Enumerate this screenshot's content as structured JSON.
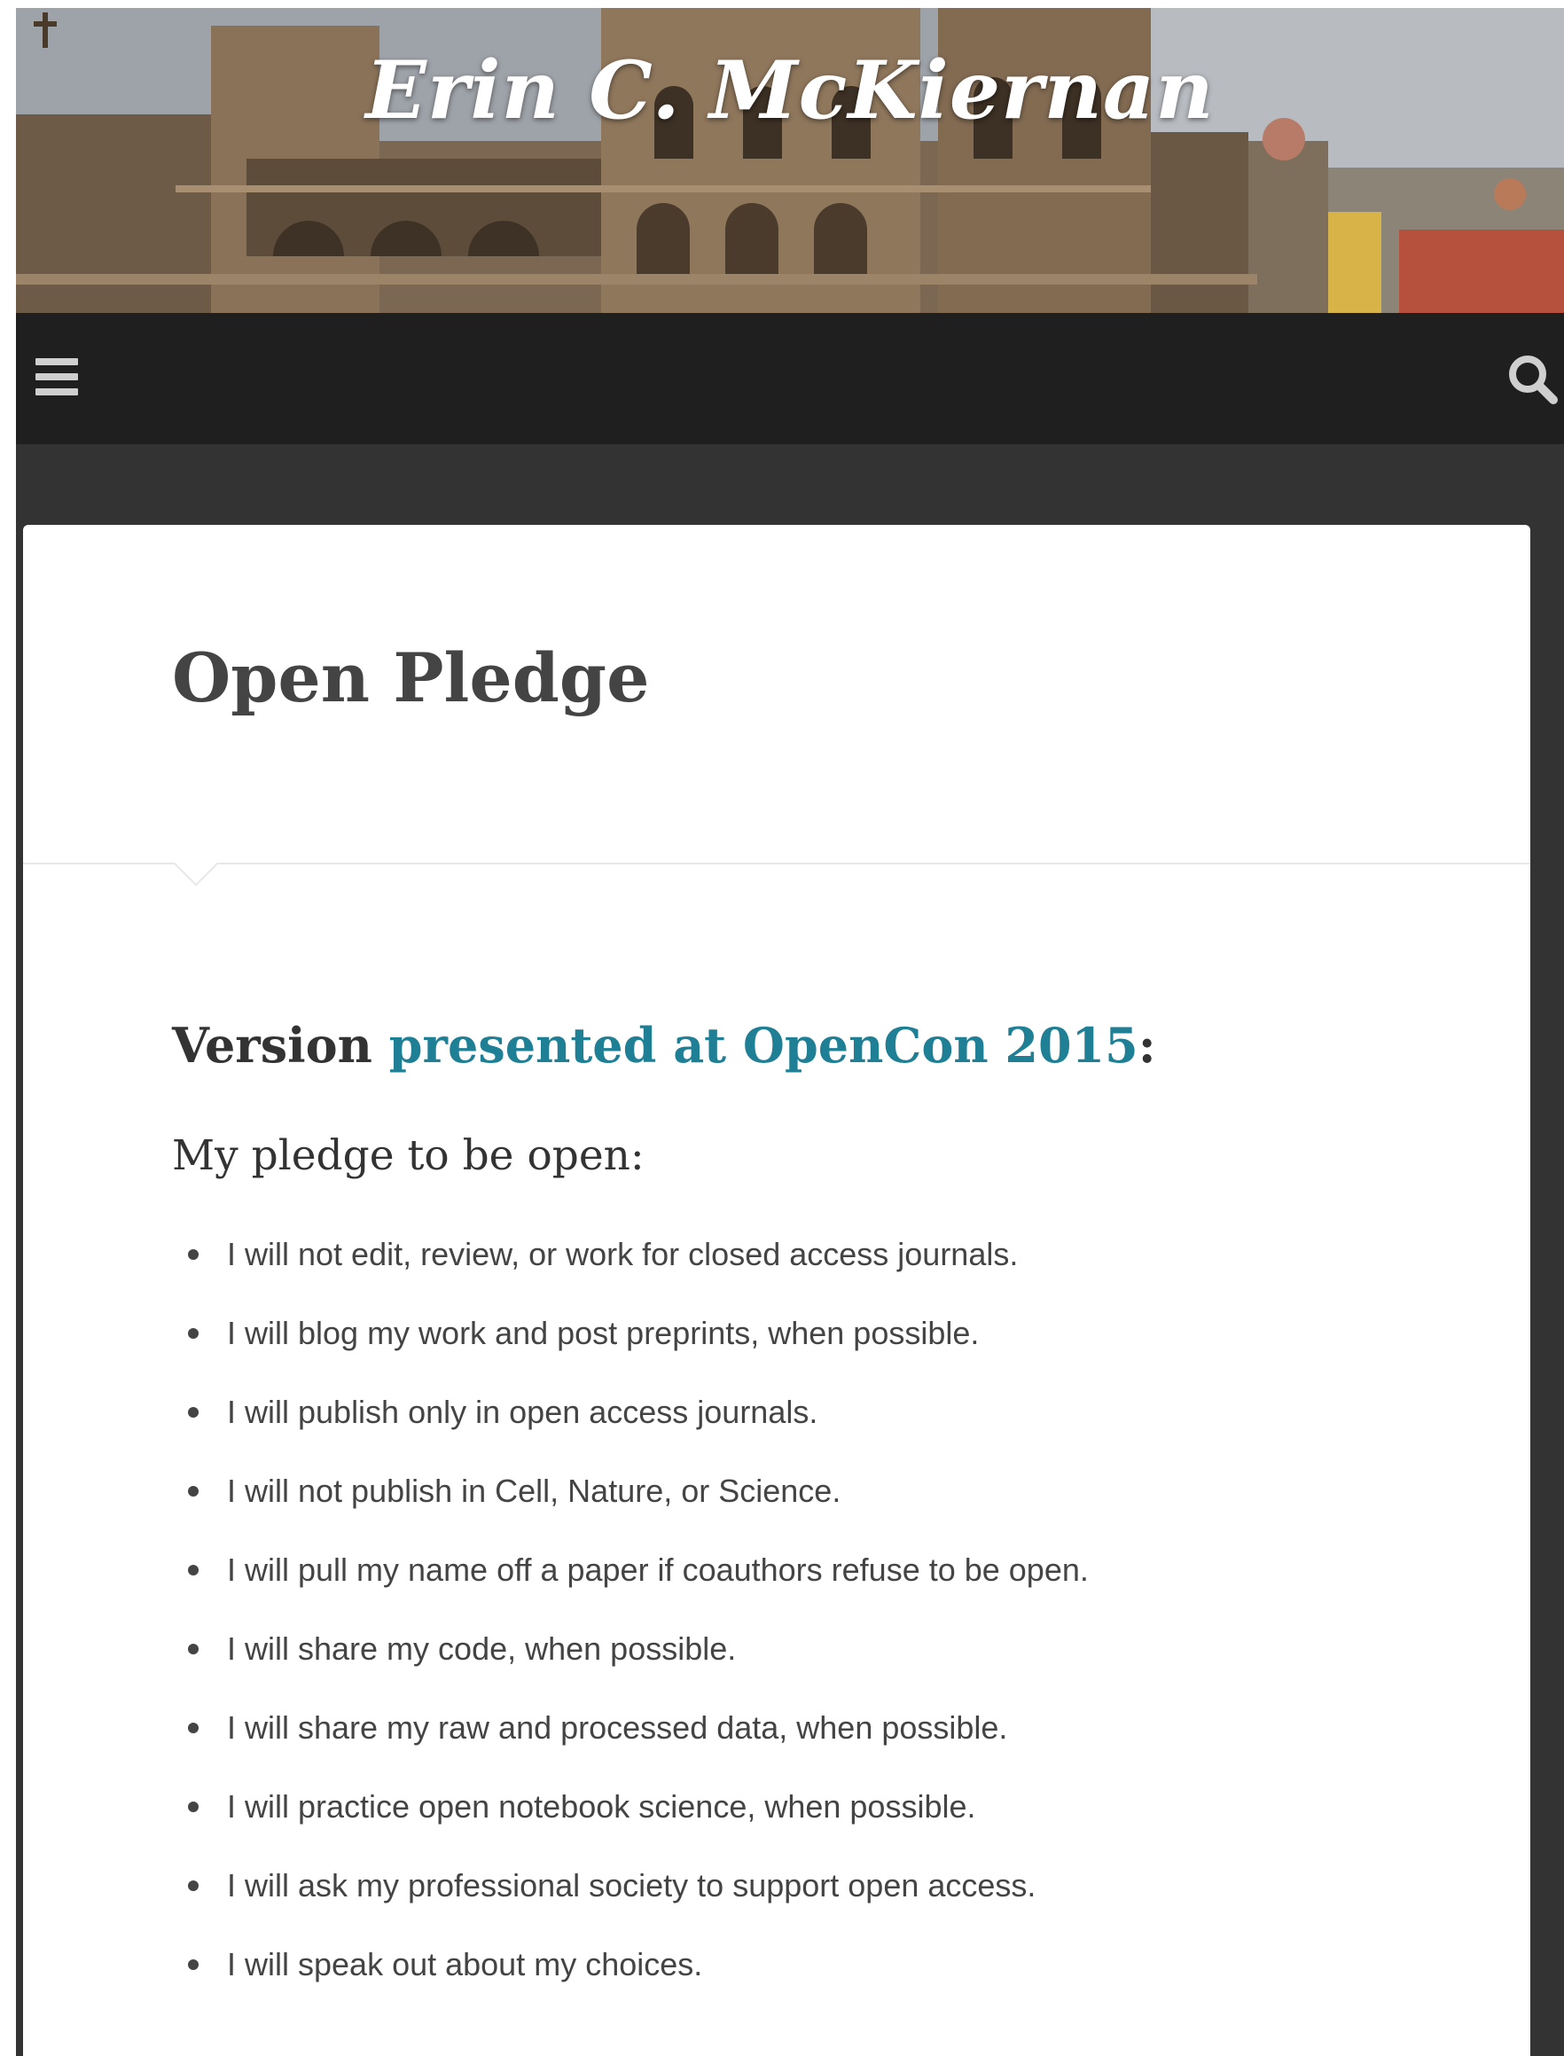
{
  "header": {
    "site_title": "Erin C. McKiernan",
    "banner_image": "cathedral-rooftops-photo"
  },
  "navbar": {
    "menu_icon": "hamburger-menu-icon",
    "search_icon": "search-icon"
  },
  "page": {
    "title": "Open Pledge",
    "version_prefix": "Version ",
    "version_link": "presented at OpenCon 2015",
    "version_suffix": ":",
    "intro": "My pledge to be open:",
    "pledges": [
      "I will not edit, review, or work for closed access journals.",
      "I will blog my work and post preprints, when possible.",
      "I will publish only in open access journals.",
      "I will not publish in Cell, Nature, or Science.",
      "I will pull my name off a paper if coauthors refuse to be open.",
      "I will share my code, when possible.",
      "I will share my raw and processed data, when possible.",
      "I will practice open notebook science, when possible.",
      "I will ask my professional society to support open access.",
      "I will speak out about my choices."
    ]
  },
  "colors": {
    "navbar": "#1f1f1f",
    "page_background": "#333333",
    "link": "#1e7f95",
    "title": "#444444"
  }
}
